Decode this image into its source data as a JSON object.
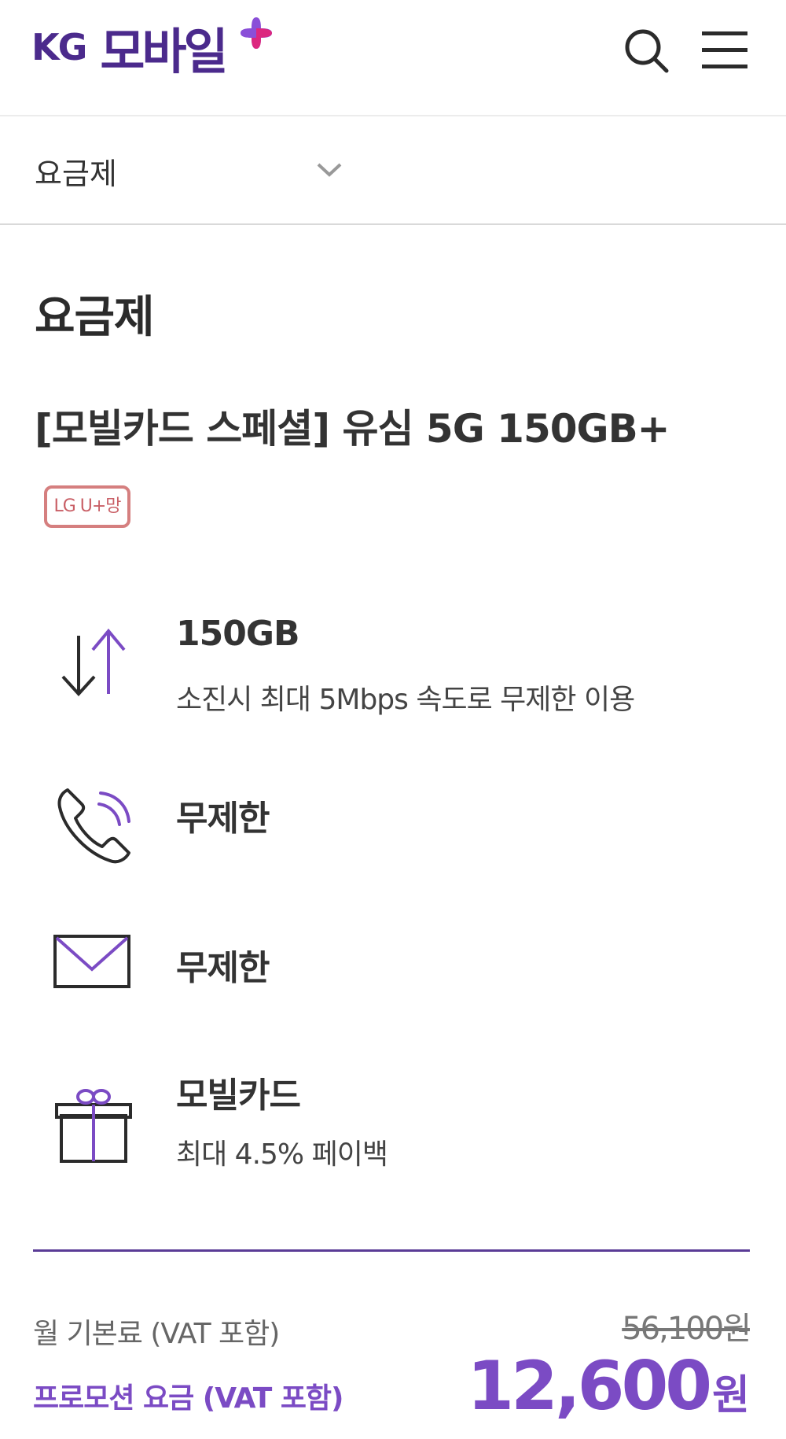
{
  "header": {
    "logo_kg": "KG",
    "logo_name": "모바일",
    "icons": {
      "search": "search-icon",
      "menu": "hamburger-menu-icon"
    },
    "brand_color": "#4b2a8c",
    "accent_colors": [
      "#8a4fd8",
      "#e0257a"
    ]
  },
  "dropdown": {
    "label": "요금제"
  },
  "page_title": "요금제",
  "plan": {
    "name": "[모빌카드 스페셜] 유심 5G 150GB+",
    "network_badge": "LG U+망"
  },
  "features": [
    {
      "icon": "data-transfer-arrows-icon",
      "title": "150GB",
      "desc": "소진시 최대 5Mbps 속도로 무제한 이용"
    },
    {
      "icon": "phone-call-icon",
      "title": "무제한",
      "desc": ""
    },
    {
      "icon": "envelope-icon",
      "title": "무제한",
      "desc": ""
    },
    {
      "icon": "gift-box-icon",
      "title": "모빌카드",
      "desc": "최대 4.5% 페이백"
    }
  ],
  "pricing": {
    "base_label": "월 기본료 (VAT 포함)",
    "promo_label": "프로모션 요금 (VAT 포함)",
    "original_price": "56,100원",
    "promo_price_number": "12,600",
    "promo_price_unit": "원",
    "accent_color": "#7b4bc4"
  }
}
